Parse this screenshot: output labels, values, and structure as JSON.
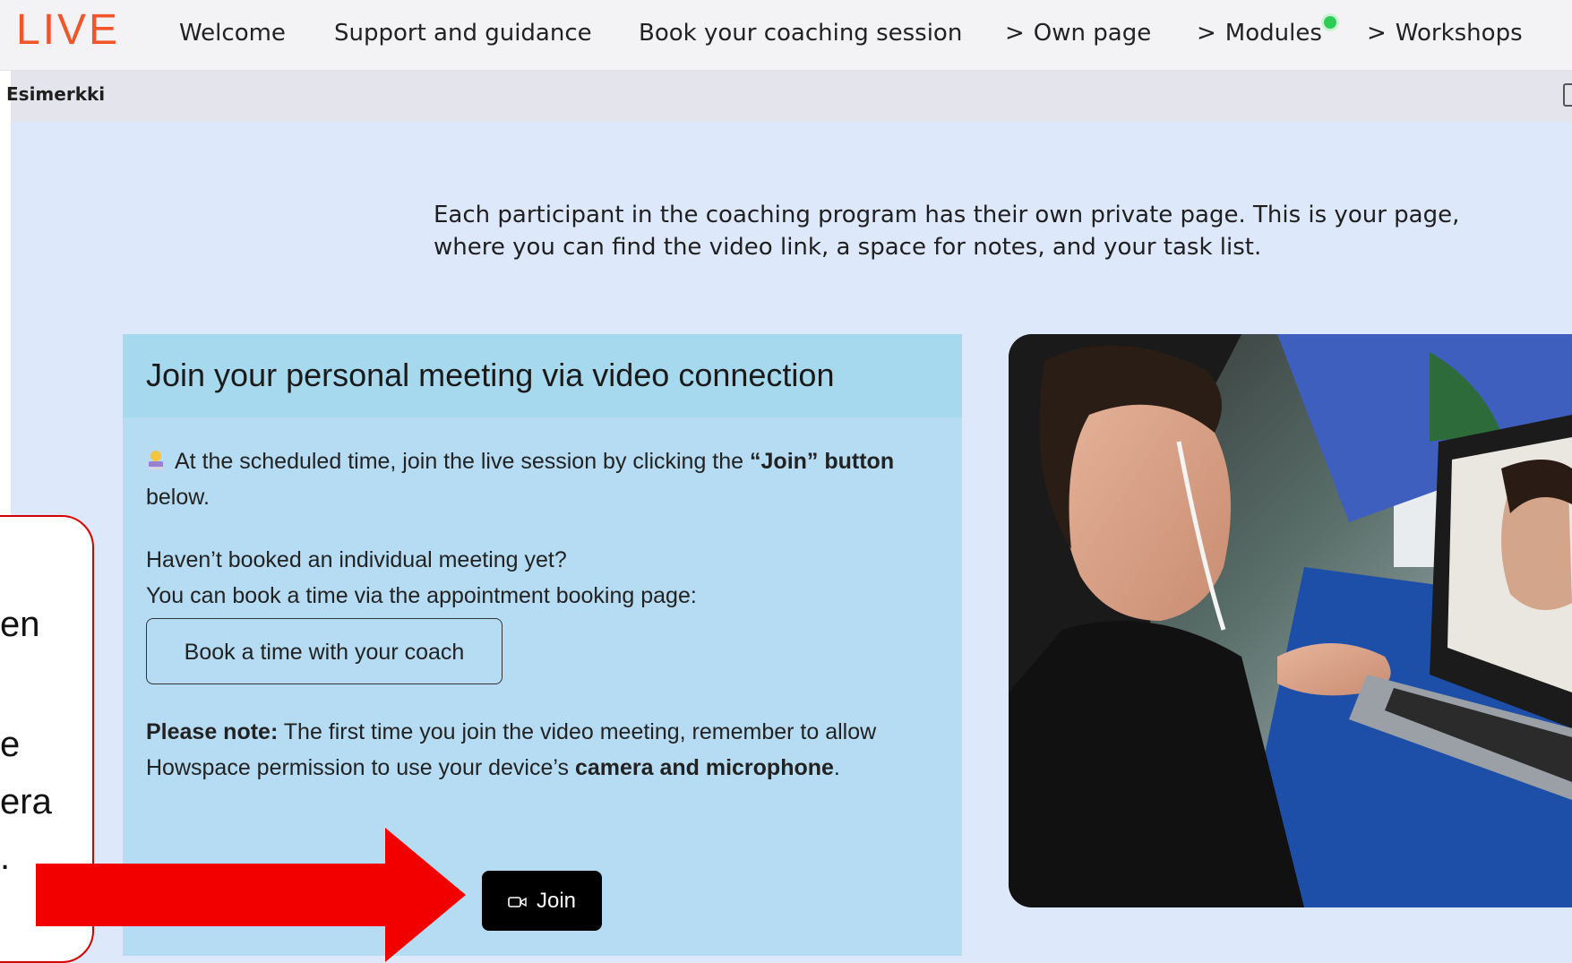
{
  "nav": {
    "logo": "LIVE",
    "items": [
      {
        "label": "Welcome",
        "chevron": ""
      },
      {
        "label": "Support and guidance",
        "chevron": ""
      },
      {
        "label": "Book your coaching session",
        "chevron": ""
      },
      {
        "label": "Own page",
        "chevron": ">"
      },
      {
        "label": "Modules",
        "chevron": ">"
      },
      {
        "label": "Workshops",
        "chevron": ">"
      }
    ],
    "modules_status_color": "#2ecc55"
  },
  "subbar": {
    "label": "Esimerkki"
  },
  "intro": "Each participant in the coaching program has their own private page. This is your page, where you can find the video link, a space for notes, and your task list.",
  "card": {
    "title": "Join your personal meeting via video connection",
    "p1_prefix": "At the scheduled time, join the live session by clicking the ",
    "p1_bold": "“Join” button",
    "p1_suffix": " below.",
    "p2_line1": "Haven’t booked an individual meeting yet?",
    "p2_line2": "You can book a time via the appointment booking page:",
    "book_button": "Book a time with your coach",
    "note_bold": "Please note:",
    "note_text": " The first time you join the video meeting, remember to allow Howspace permission to use your device’s ",
    "note_bold2": "camera and microphone",
    "note_end": ".",
    "join_button": "Join",
    "join_icon": "video-camera-icon"
  },
  "callout": {
    "lines": [
      "en",
      "e",
      "era",
      "."
    ],
    "border_color": "#d40000"
  },
  "arrow_color": "#f20000",
  "photo_alt": "woman-video-call-photo"
}
